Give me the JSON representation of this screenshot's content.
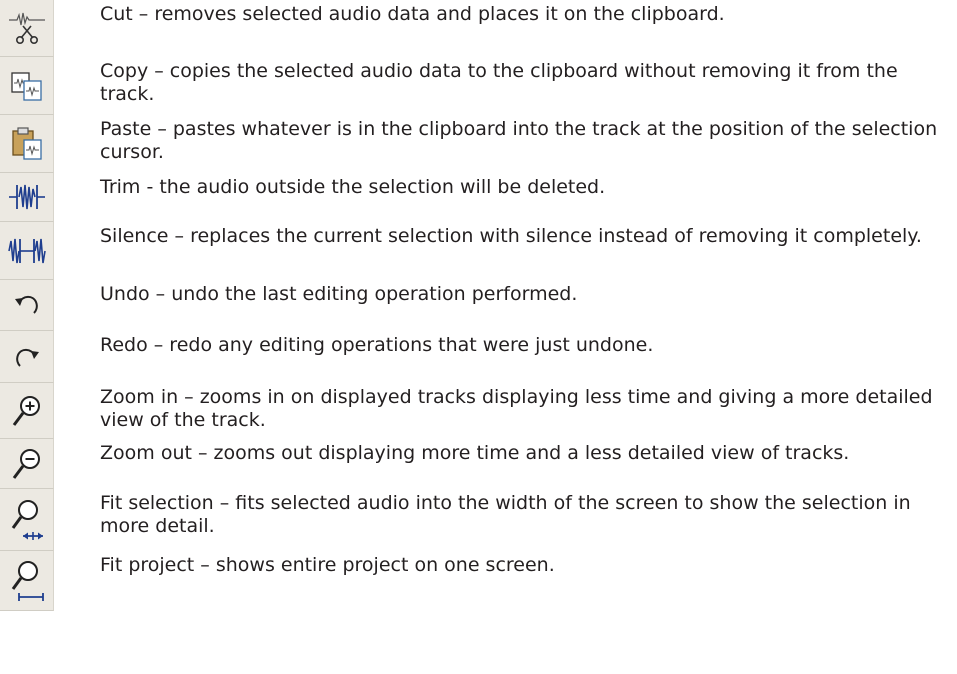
{
  "entries": [
    {
      "icon": "cut-icon",
      "text": "Cut – removes selected audio data and places it on the clipboard."
    },
    {
      "icon": "copy-icon",
      "text": "Copy – copies the selected audio data to the clipboard without removing it from the track."
    },
    {
      "icon": "paste-icon",
      "text": "Paste – pastes whatever is in the clipboard into the track at the position of the selection cursor."
    },
    {
      "icon": "trim-icon",
      "text": "Trim - the audio outside the selection will be deleted."
    },
    {
      "icon": "silence-icon",
      "text": "Silence – replaces the current selection with silence instead of removing it completely."
    },
    {
      "icon": "undo-icon",
      "text": "Undo – undo the last editing operation performed."
    },
    {
      "icon": "redo-icon",
      "text": "Redo – redo any editing operations that were just undone."
    },
    {
      "icon": "zoom-in-icon",
      "text": "Zoom in – zooms in on displayed tracks displaying less time and giving a more detailed view of the track."
    },
    {
      "icon": "zoom-out-icon",
      "text": "Zoom out – zooms out displaying more time and a less detailed view of tracks."
    },
    {
      "icon": "fit-selection-icon",
      "text": "Fit selection – fits selected audio into the width of the screen to show the selection in more detail."
    },
    {
      "icon": "fit-project-icon",
      "text": "Fit project – shows entire project on one screen."
    }
  ]
}
